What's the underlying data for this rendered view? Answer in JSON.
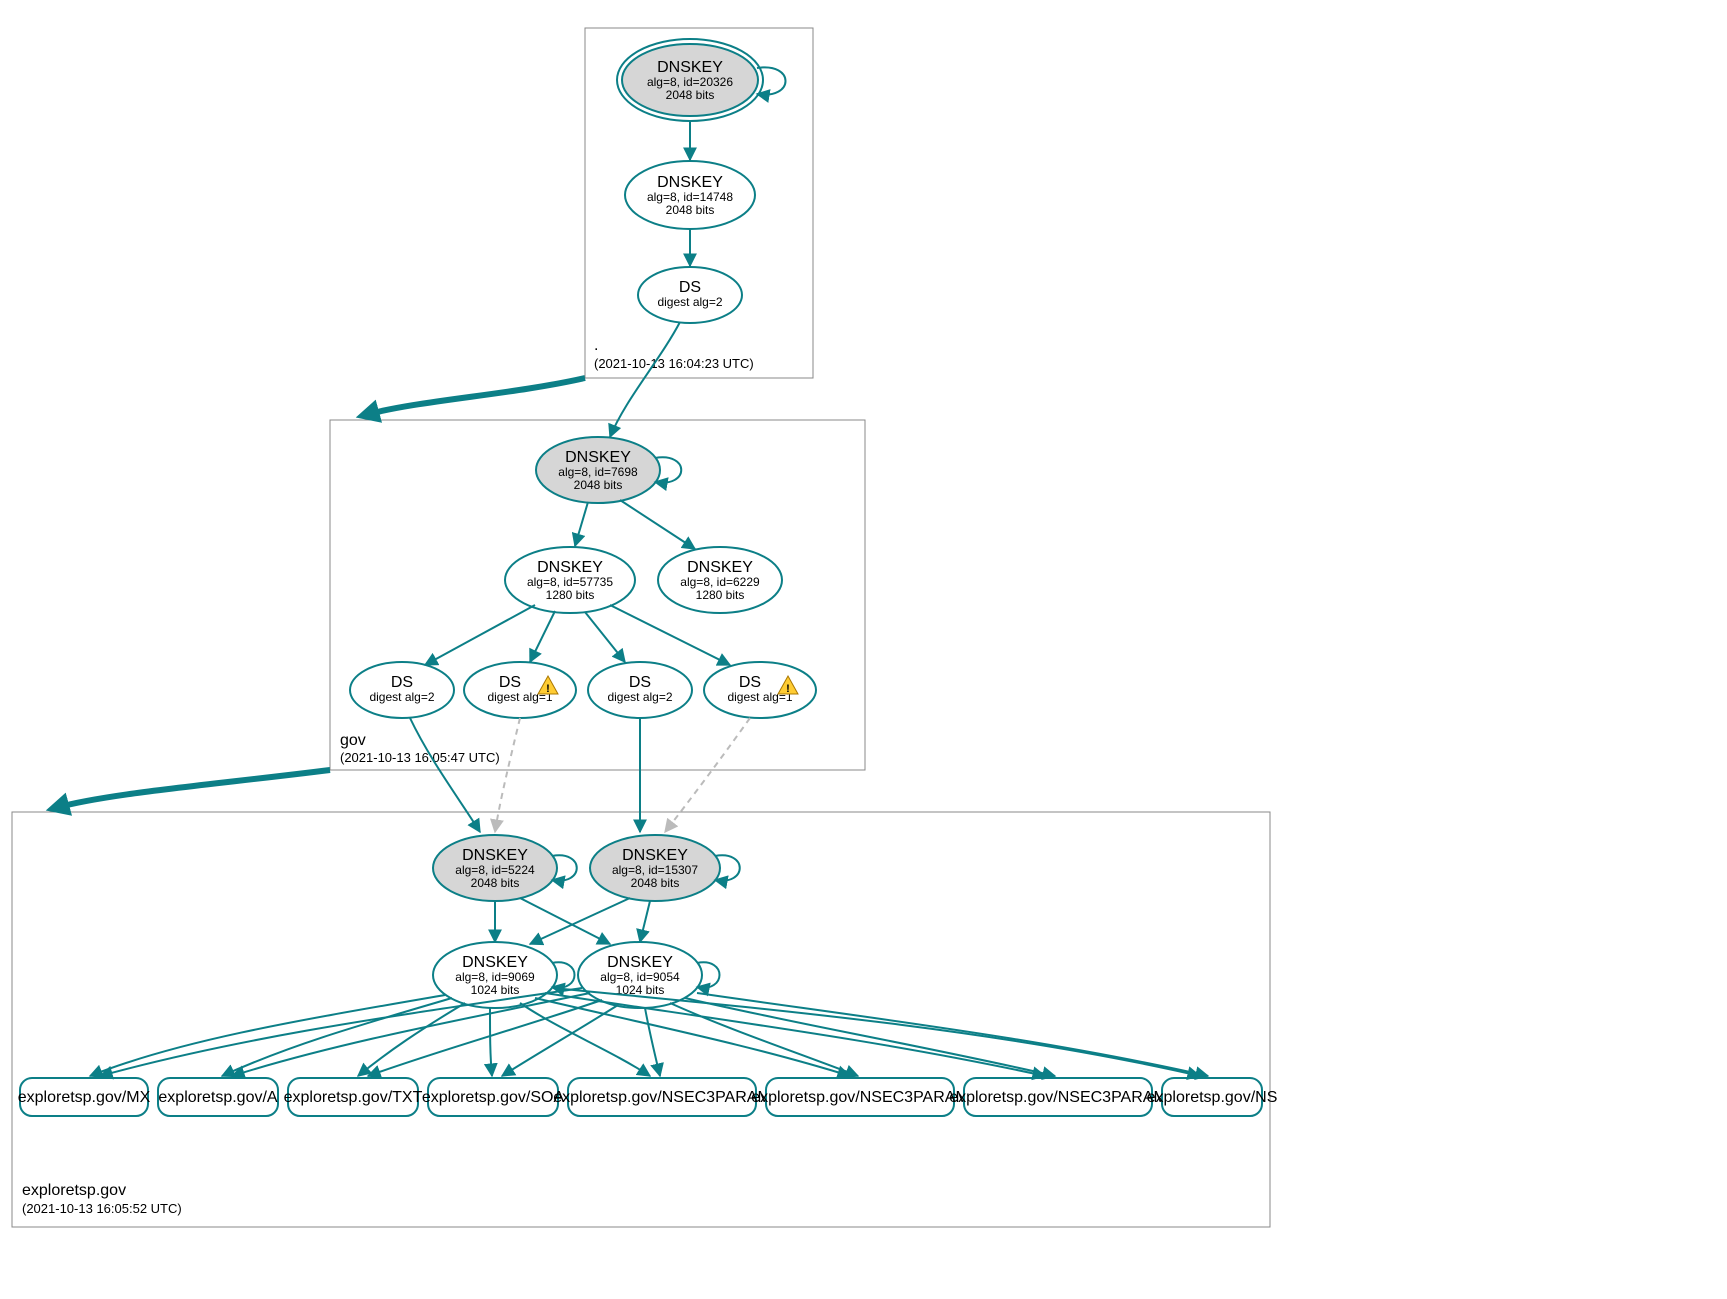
{
  "colors": {
    "secure_stroke": "#0c7f87",
    "node_fill_grey": "#d6d6d6",
    "dashed_stroke": "#bbbbbb",
    "warn_fill": "#ffcc33"
  },
  "zones": {
    "root": {
      "label": ".",
      "timestamp": "(2021-10-13 16:04:23 UTC)",
      "nodes": {
        "ksk": {
          "title": "DNSKEY",
          "line2": "alg=8, id=20326",
          "line3": "2048 bits"
        },
        "zsk": {
          "title": "DNSKEY",
          "line2": "alg=8, id=14748",
          "line3": "2048 bits"
        },
        "ds": {
          "title": "DS",
          "line2": "digest alg=2"
        }
      }
    },
    "gov": {
      "label": "gov",
      "timestamp": "(2021-10-13 16:05:47 UTC)",
      "nodes": {
        "ksk": {
          "title": "DNSKEY",
          "line2": "alg=8, id=7698",
          "line3": "2048 bits"
        },
        "zsk1": {
          "title": "DNSKEY",
          "line2": "alg=8, id=57735",
          "line3": "1280 bits"
        },
        "zsk2": {
          "title": "DNSKEY",
          "line2": "alg=8, id=6229",
          "line3": "1280 bits"
        },
        "ds1": {
          "title": "DS",
          "line2": "digest alg=2"
        },
        "ds2": {
          "title": "DS",
          "line2": "digest alg=1",
          "warning": true
        },
        "ds3": {
          "title": "DS",
          "line2": "digest alg=2"
        },
        "ds4": {
          "title": "DS",
          "line2": "digest alg=1",
          "warning": true
        }
      }
    },
    "exploretsp": {
      "label": "exploretsp.gov",
      "timestamp": "(2021-10-13 16:05:52 UTC)",
      "nodes": {
        "ksk1": {
          "title": "DNSKEY",
          "line2": "alg=8, id=5224",
          "line3": "2048 bits"
        },
        "ksk2": {
          "title": "DNSKEY",
          "line2": "alg=8, id=15307",
          "line3": "2048 bits"
        },
        "zsk1": {
          "title": "DNSKEY",
          "line2": "alg=8, id=9069",
          "line3": "1024 bits"
        },
        "zsk2": {
          "title": "DNSKEY",
          "line2": "alg=8, id=9054",
          "line3": "1024 bits"
        }
      },
      "rrsets": {
        "mx": "exploretsp.gov/MX",
        "a": "exploretsp.gov/A",
        "txt": "exploretsp.gov/TXT",
        "soa": "exploretsp.gov/SOA",
        "nsec1": "exploretsp.gov/NSEC3PARAM",
        "nsec2": "exploretsp.gov/NSEC3PARAM",
        "nsec3": "exploretsp.gov/NSEC3PARAM",
        "ns": "exploretsp.gov/NS"
      }
    }
  }
}
